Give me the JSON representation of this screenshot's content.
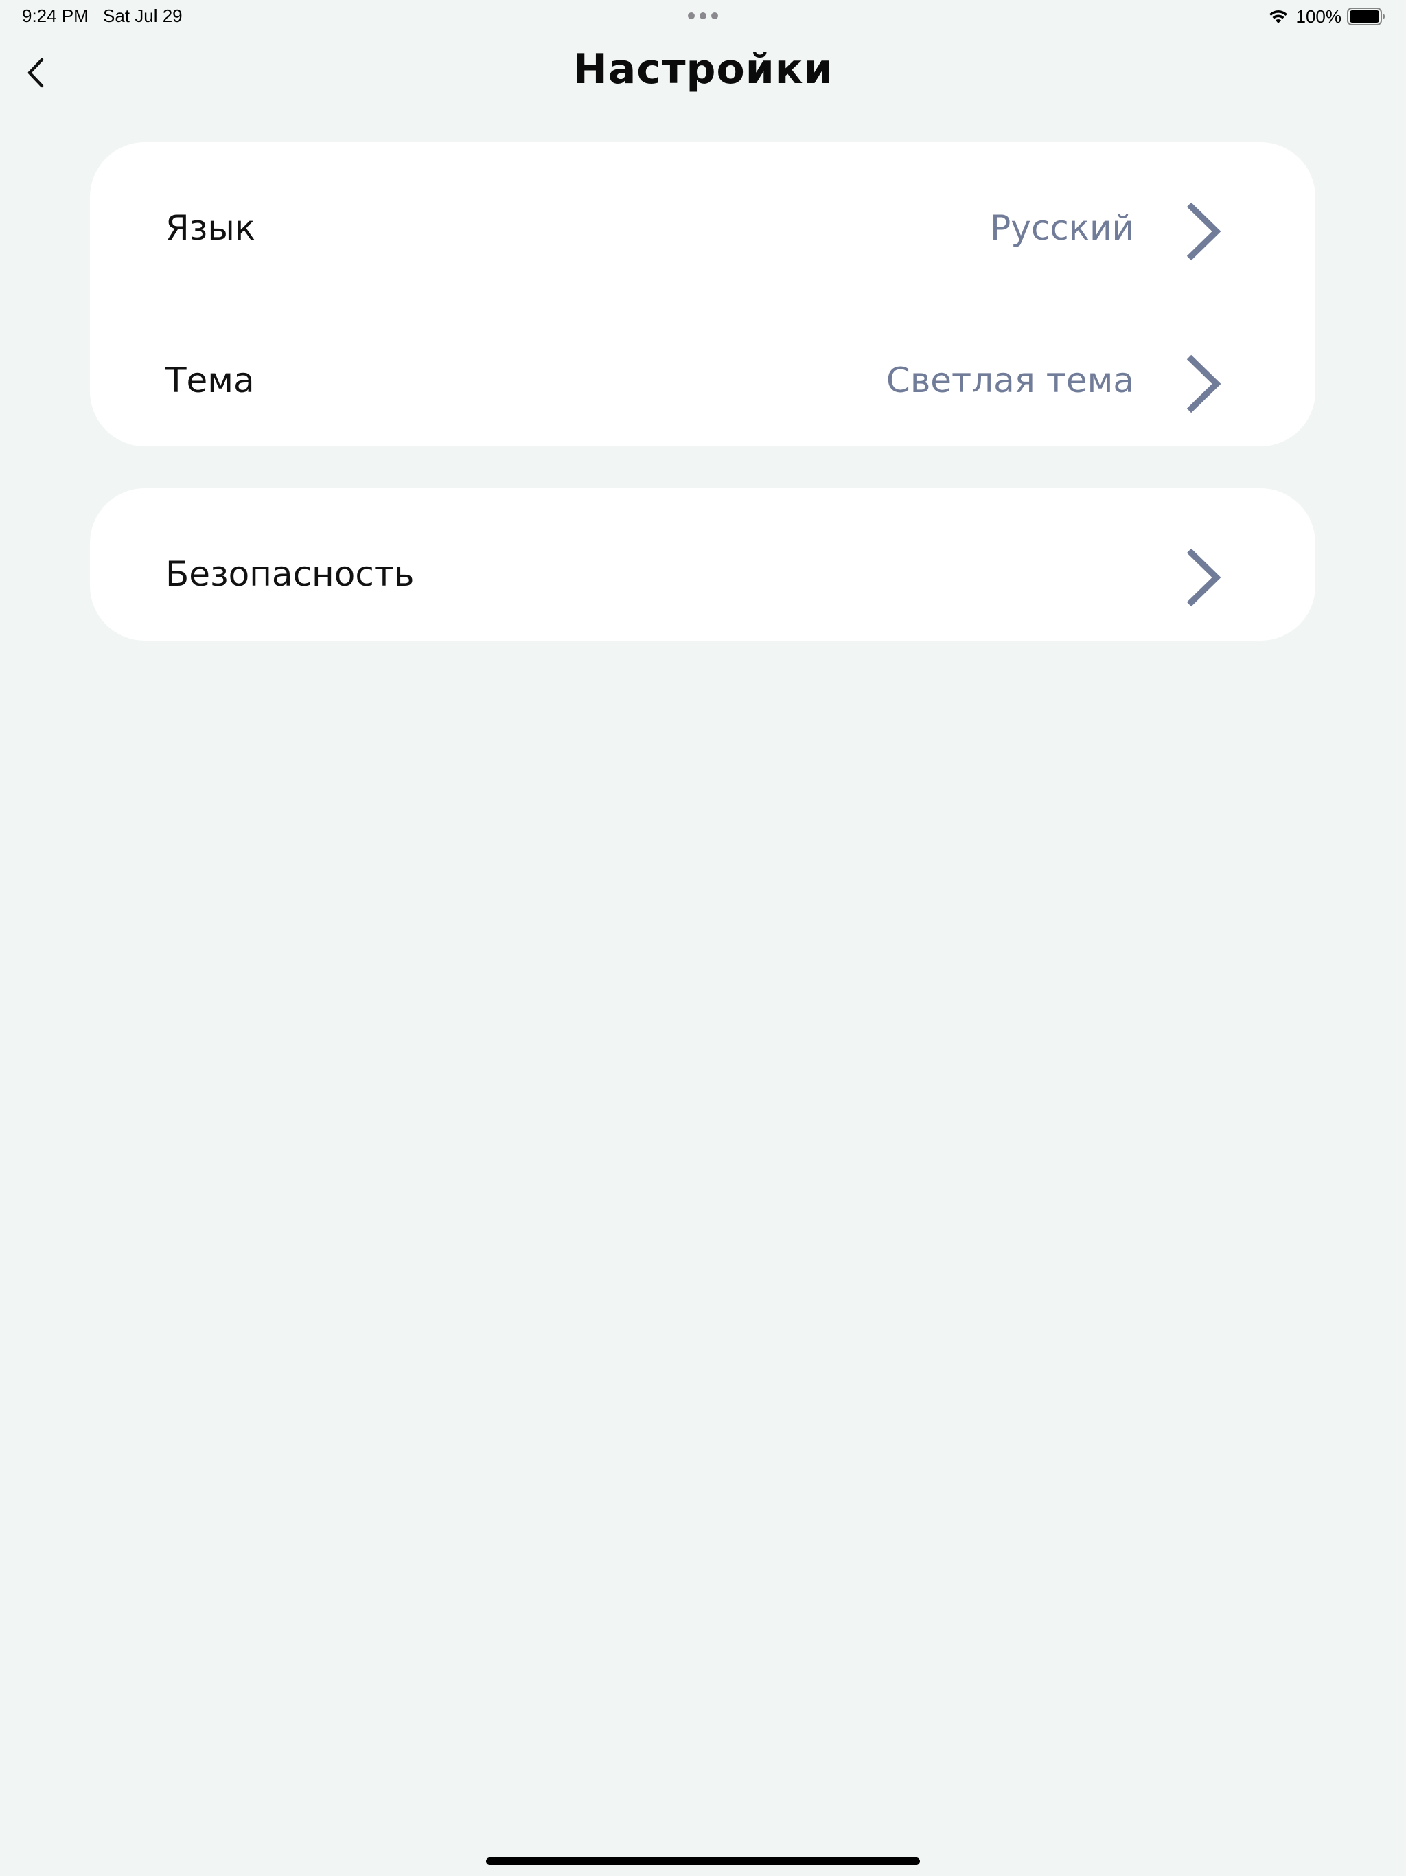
{
  "status_bar": {
    "time": "9:24 PM",
    "date": "Sat Jul 29",
    "battery_percent": "100%",
    "icons": [
      "wifi-icon",
      "battery-icon"
    ]
  },
  "header": {
    "title": "Настройки",
    "back_icon": "chevron-left-icon"
  },
  "settings": {
    "group1": {
      "language": {
        "label": "Язык",
        "value": "Русский"
      },
      "theme": {
        "label": "Тема",
        "value": "Светлая тема"
      }
    },
    "group2": {
      "security": {
        "label": "Безопасность"
      }
    }
  },
  "colors": {
    "background": "#f1f5f4",
    "card": "#ffffff",
    "secondary_text": "#717c99",
    "chevron": "#717c99"
  }
}
